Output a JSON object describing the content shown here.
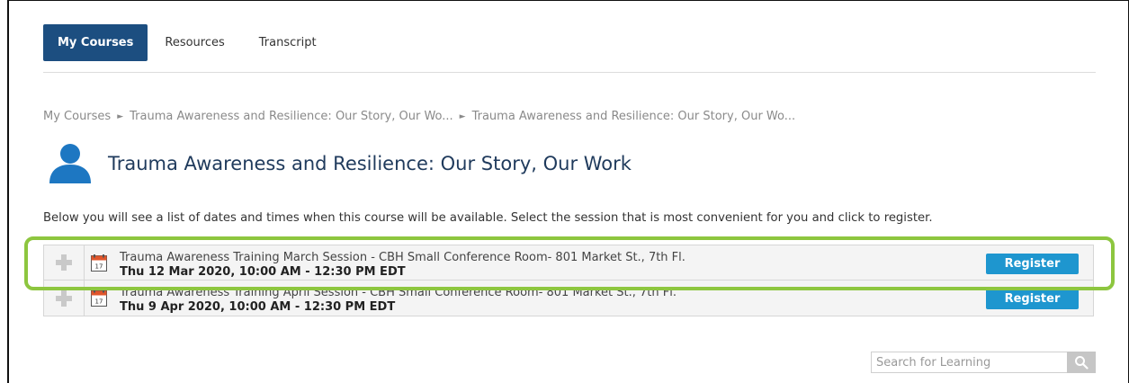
{
  "nav": {
    "tabs": [
      {
        "label": "My Courses",
        "active": true
      },
      {
        "label": "Resources",
        "active": false
      },
      {
        "label": "Transcript",
        "active": false
      }
    ]
  },
  "breadcrumb": [
    "My Courses",
    "Trauma Awareness and Resilience: Our Story, Our Wo...",
    "Trauma Awareness and Resilience: Our Story, Our Wo..."
  ],
  "page": {
    "title": "Trauma Awareness and Resilience: Our Story, Our Work",
    "icon": "person-icon",
    "intro": "Below you will see a list of dates and times when this course will be available.  Select the session that is most convenient for you and click to register."
  },
  "sessions": [
    {
      "title": "Trauma Awareness Training March Session - CBH Small Conference Room- 801 Market St., 7th Fl.",
      "datetime": "Thu 12 Mar 2020, 10:00 AM - 12:30 PM EDT",
      "register_label": "Register",
      "calendar_day": "17",
      "highlighted": true
    },
    {
      "title": "Trauma Awareness Training April Session - CBH Small Conference Room- 801 Market St., 7th Fl.",
      "datetime": "Thu 9 Apr 2020, 10:00 AM - 12:30 PM EDT",
      "register_label": "Register",
      "calendar_day": "17",
      "highlighted": false
    }
  ],
  "search": {
    "placeholder": "Search for Learning",
    "value": ""
  },
  "colors": {
    "active_tab": "#1c4e80",
    "title": "#1f3a5c",
    "register_button": "#1e96cf",
    "highlight": "#8dc63f"
  }
}
